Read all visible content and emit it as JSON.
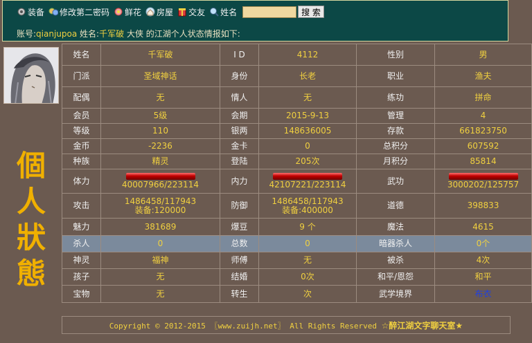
{
  "nav": {
    "items": [
      {
        "label": "装备",
        "icon": "equipment-icon"
      },
      {
        "label": "修改第二密码",
        "icon": "password-icon"
      },
      {
        "label": "鲜花",
        "icon": "flower-icon"
      },
      {
        "label": "房屋",
        "icon": "house-icon"
      },
      {
        "label": "交友",
        "icon": "friend-icon"
      },
      {
        "label": "姓名",
        "icon": "search-name-icon"
      }
    ],
    "search_value": "",
    "search_button": "搜 索"
  },
  "info": {
    "account_label": "账号:",
    "account": "qianjupoa",
    "name_label": "姓名:",
    "name": "千军破",
    "suffix": "大侠 的江湖个人状态情报如下:"
  },
  "side_title": [
    "個",
    "人",
    "狀",
    "態"
  ],
  "stats": {
    "r1": [
      "姓名",
      "千军破",
      "I D",
      "4112",
      "性别",
      "男"
    ],
    "r2": [
      "门派",
      "圣域神话",
      "身份",
      "长老",
      "职业",
      "渔夫"
    ],
    "r3": [
      "配偶",
      "无",
      "情人",
      "无",
      "练功",
      "拼命"
    ],
    "r4": [
      "会员",
      "5级",
      "会期",
      "2015-9-13",
      "管理",
      "4"
    ],
    "r5": [
      "等级",
      "110",
      "银两",
      "148636005",
      "存款",
      "661823750"
    ],
    "r6": [
      "金币",
      "-2236",
      "金卡",
      "0",
      "总积分",
      "607592"
    ],
    "r7": [
      "种族",
      "精灵",
      "登陆",
      "205次",
      "月积分",
      "85814"
    ],
    "r8": [
      "体力",
      "40007966/223114",
      "内力",
      "42107221/223114",
      "武功",
      "3000202/125757"
    ],
    "r9": [
      "攻击",
      "1486458/117943",
      "装备:120000",
      "防御",
      "1486458/117943",
      "装备:400000",
      "道德",
      "398833"
    ],
    "r10": [
      "魅力",
      "381689",
      "爆豆",
      "9 个",
      "魔法",
      "4615"
    ],
    "r11": [
      "杀人",
      "0",
      "总数",
      "0",
      "暗器杀人",
      "0个"
    ],
    "r12": [
      "神灵",
      "福神",
      "师傅",
      "无",
      "被杀",
      "4次"
    ],
    "r13": [
      "孩子",
      "无",
      "结婚",
      "0次",
      "和平/恩怨",
      "和平"
    ],
    "r14": [
      "宝物",
      "无",
      "转生",
      "次",
      "武学境界",
      "布衣"
    ]
  },
  "bars": {
    "hp": 1.0,
    "mp": 1.0,
    "kungfu": 1.0
  },
  "footer": {
    "copyright": "Copyright © 2012-2015 〖www.zuijh.net〗 All Rights Reserved",
    "brand": "☆醉江湖文字聊天室★"
  },
  "colors": {
    "panel": "#0c4846",
    "bg": "#6b5a50",
    "value": "#f0d040",
    "highlight_row": "#7b8a9c"
  }
}
